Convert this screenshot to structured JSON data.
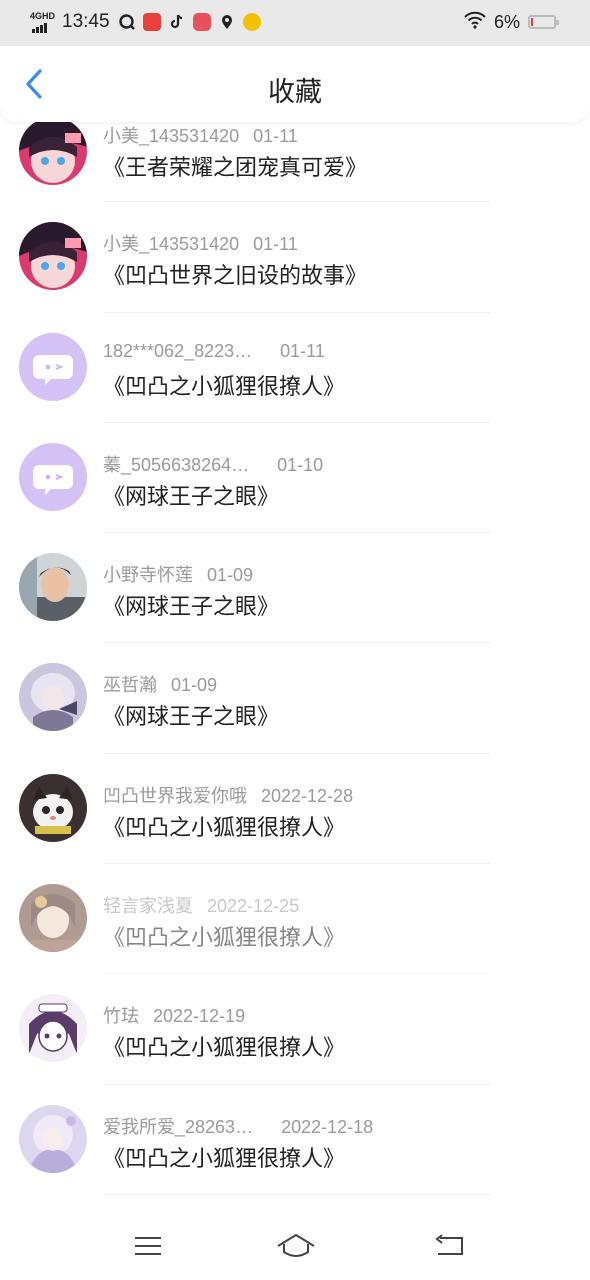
{
  "status_bar": {
    "network": "4GHD",
    "time": "13:45",
    "battery_percent": "6%",
    "battery_level": 0.06
  },
  "header": {
    "title": "收藏"
  },
  "items": [
    {
      "user": "小美_143531420",
      "date": "01-11",
      "title": "《王者荣耀之团宠真可爱》"
    },
    {
      "user": "小美_143531420",
      "date": "01-11",
      "title": "《凹凸世界之旧设的故事》"
    },
    {
      "user": "182***062_8223…",
      "date": "01-11",
      "title": "《凹凸之小狐狸很撩人》"
    },
    {
      "user": "蓁_5056638264…",
      "date": "01-10",
      "title": "《网球王子之眼》"
    },
    {
      "user": "小野寺怀莲",
      "date": "01-09",
      "title": "《网球王子之眼》"
    },
    {
      "user": "巫哲瀚",
      "date": "01-09",
      "title": "《网球王子之眼》"
    },
    {
      "user": "凹凸世界我爱你哦",
      "date": "2022-12-28",
      "title": "《凹凸之小狐狸很撩人》"
    },
    {
      "user": "轻言家浅夏",
      "date": "2022-12-25",
      "title": "《凹凸之小狐狸很撩人》"
    },
    {
      "user": "竹珐",
      "date": "2022-12-19",
      "title": "《凹凸之小狐狸很撩人》"
    },
    {
      "user": "爱我所爱_28263…",
      "date": "2022-12-18",
      "title": "《凹凸之小狐狸很撩人》"
    }
  ],
  "colors": {
    "accent": "#3a8ee6",
    "default_avatar": "#d3c2f3"
  }
}
